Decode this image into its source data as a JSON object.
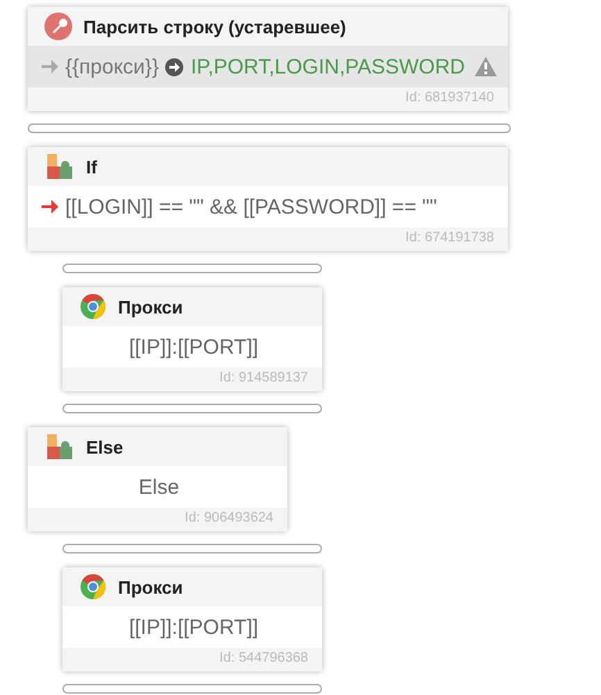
{
  "blocks": [
    {
      "kind": "parse",
      "title": "Парсить строку (устаревшее)",
      "input": "{{прокси}}",
      "output": "IP,PORT,LOGIN,PASSWORD",
      "id": "Id: 681937140"
    },
    {
      "kind": "if",
      "title": "If",
      "text": "[[LOGIN]] == \"\" && [[PASSWORD]] == \"\"",
      "id": "Id: 674191738",
      "children": [
        {
          "kind": "proxy",
          "title": "Прокси",
          "text": "[[IP]]:[[PORT]]",
          "id": "Id: 914589137"
        }
      ]
    },
    {
      "kind": "else",
      "title": "Else",
      "text": "Else",
      "id": "Id: 906493624",
      "children": [
        {
          "kind": "proxy",
          "title": "Прокси",
          "text": "[[IP]]:[[PORT]]",
          "id": "Id: 544796368"
        }
      ]
    }
  ]
}
